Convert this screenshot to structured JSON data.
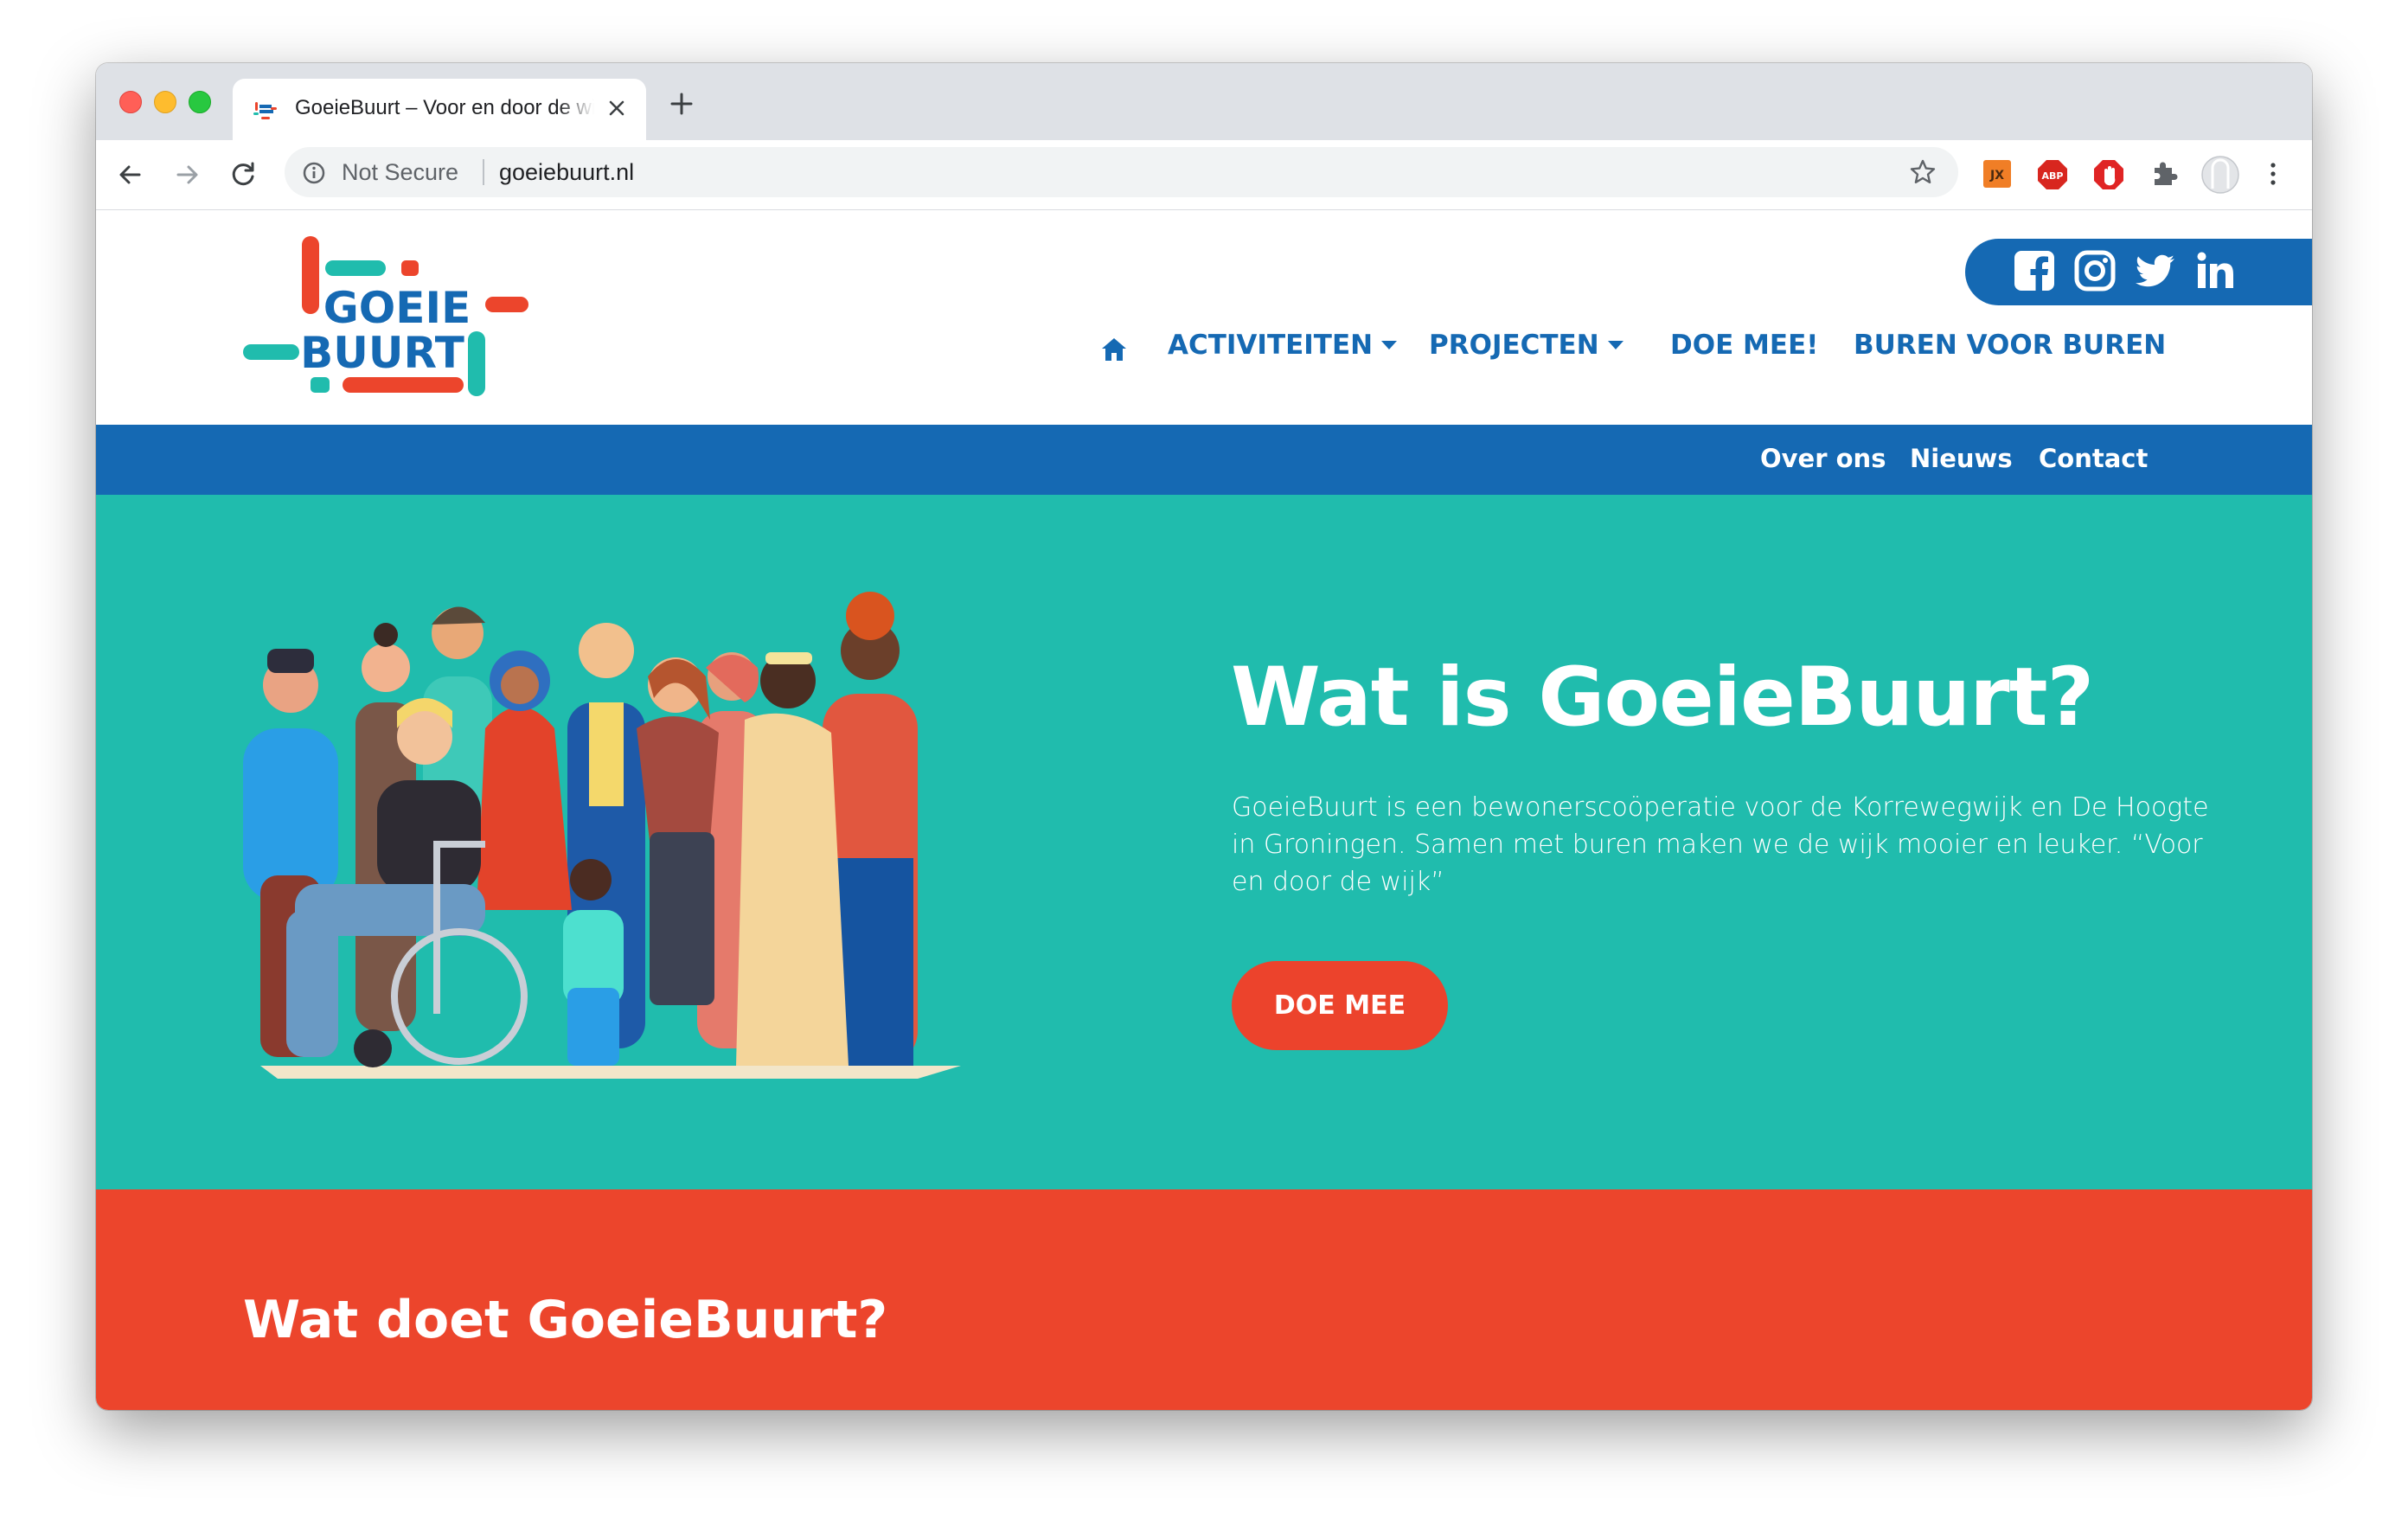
{
  "browser": {
    "tab_title": "GoeieBuurt – Voor en door de wijk",
    "security_label": "Not Secure",
    "url": "goeiebuurt.nl"
  },
  "extensions": [
    "jx-extension-icon",
    "adblock-plus-icon",
    "ublock-icon",
    "extensions-puzzle-icon",
    "profile-avatar-icon"
  ],
  "logo": {
    "line1": "GOEIE",
    "line2": "BUURT",
    "colors": {
      "blue": "#1569b3",
      "red": "#ec452c",
      "teal": "#20bcad"
    }
  },
  "social": [
    "facebook-icon",
    "instagram-icon",
    "twitter-icon",
    "linkedin-icon"
  ],
  "nav": {
    "home_icon": "home-icon",
    "items": [
      {
        "label": "ACTIVITEITEN",
        "dropdown": true
      },
      {
        "label": "PROJECTEN",
        "dropdown": true
      },
      {
        "label": "DOE MEE!",
        "dropdown": false
      },
      {
        "label": "BUREN VOOR BUREN",
        "dropdown": false
      }
    ]
  },
  "subnav": [
    "Over ons",
    "Nieuws",
    "Contact"
  ],
  "hero": {
    "title": "Wat is GoeieBuurt?",
    "text": "GoeieBuurt is een bewonerscoöperatie voor de Korrewegwijk en De Hoogte in Groningen. Samen met buren maken we de wijk mooier en leuker. “Voor en door de wijk”",
    "button": "DOE MEE",
    "background": "#20bcad",
    "button_color": "#ec432c"
  },
  "section2": {
    "title": "Wat doet GoeieBuurt?",
    "background": "#ec452c"
  },
  "colors": {
    "brand_blue": "#1569b3"
  }
}
